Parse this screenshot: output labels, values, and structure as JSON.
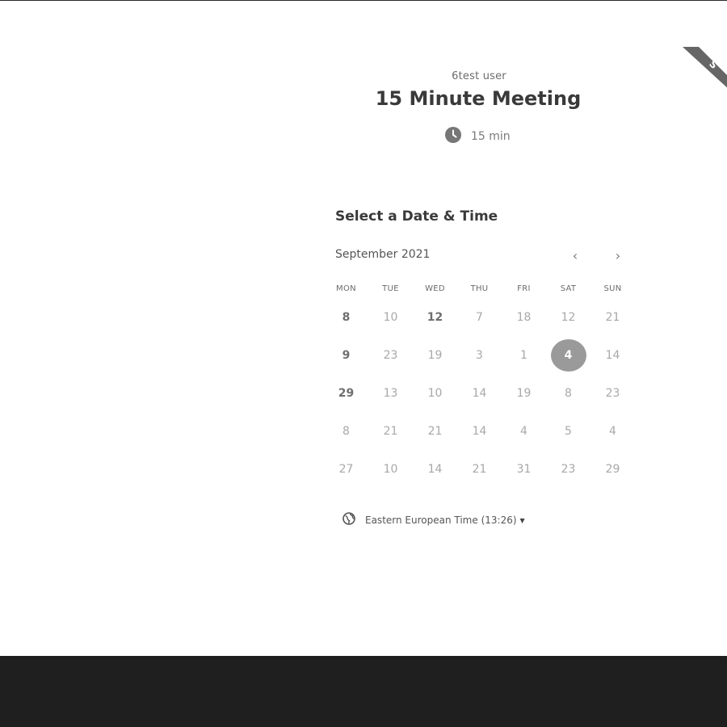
{
  "header": {
    "host_name": "6test user",
    "event_title": "15 Minute Meeting",
    "duration": "15 min",
    "duration_icon": "clock-icon",
    "ribbon_text": "S"
  },
  "calendar": {
    "section_title": "Select a Date & Time",
    "month": "September 2021",
    "prev_label": "‹",
    "next_label": "›",
    "weekdays": [
      "MON",
      "TUE",
      "WED",
      "THU",
      "FRI",
      "SAT",
      "SUN"
    ],
    "weeks": [
      [
        {
          "d": "8",
          "s": "available"
        },
        {
          "d": "10",
          "s": "disabled"
        },
        {
          "d": "12",
          "s": "available"
        },
        {
          "d": "7",
          "s": "disabled"
        },
        {
          "d": "18",
          "s": "disabled"
        },
        {
          "d": "12",
          "s": "disabled"
        },
        {
          "d": "21",
          "s": "disabled"
        }
      ],
      [
        {
          "d": "9",
          "s": "available"
        },
        {
          "d": "23",
          "s": "disabled"
        },
        {
          "d": "19",
          "s": "disabled"
        },
        {
          "d": "3",
          "s": "disabled"
        },
        {
          "d": "1",
          "s": "disabled"
        },
        {
          "d": "4",
          "s": "selected"
        },
        {
          "d": "14",
          "s": "disabled"
        }
      ],
      [
        {
          "d": "29",
          "s": "available"
        },
        {
          "d": "13",
          "s": "disabled"
        },
        {
          "d": "10",
          "s": "disabled"
        },
        {
          "d": "14",
          "s": "disabled"
        },
        {
          "d": "19",
          "s": "disabled"
        },
        {
          "d": "8",
          "s": "disabled"
        },
        {
          "d": "23",
          "s": "disabled"
        }
      ],
      [
        {
          "d": "8",
          "s": "disabled"
        },
        {
          "d": "21",
          "s": "disabled"
        },
        {
          "d": "21",
          "s": "disabled"
        },
        {
          "d": "14",
          "s": "disabled"
        },
        {
          "d": "4",
          "s": "disabled"
        },
        {
          "d": "5",
          "s": "disabled"
        },
        {
          "d": "4",
          "s": "disabled"
        }
      ],
      [
        {
          "d": "27",
          "s": "disabled"
        },
        {
          "d": "10",
          "s": "disabled"
        },
        {
          "d": "14",
          "s": "disabled"
        },
        {
          "d": "21",
          "s": "disabled"
        },
        {
          "d": "31",
          "s": "disabled"
        },
        {
          "d": "23",
          "s": "disabled"
        },
        {
          "d": "29",
          "s": "disabled"
        }
      ]
    ]
  },
  "timezone": {
    "label": "Eastern European Time (13:26)",
    "icon": "globe-icon"
  },
  "colors": {
    "selected_day_bg": "#9a9a9a",
    "footer_bg": "#1f1f1f",
    "ribbon_bg": "#666666"
  }
}
